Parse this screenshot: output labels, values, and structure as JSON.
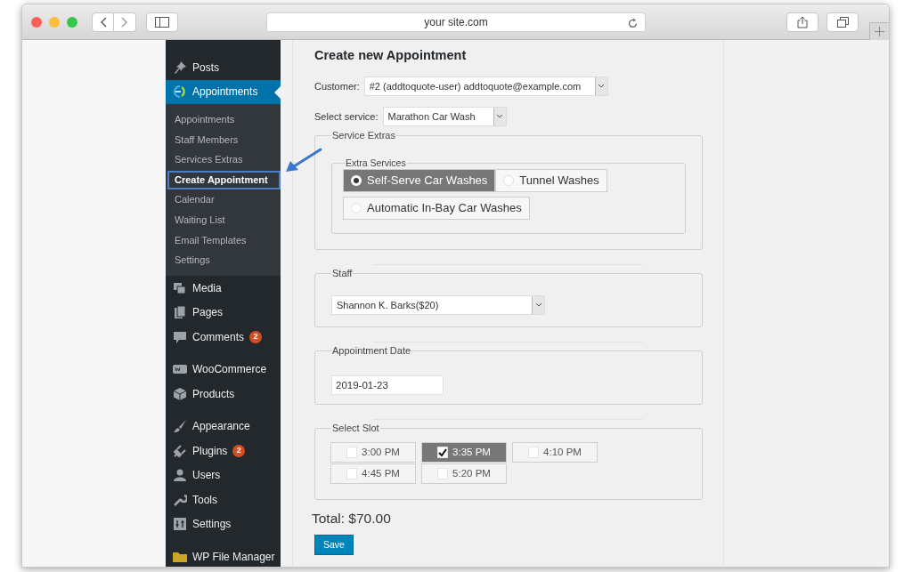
{
  "browser": {
    "url": "your site.com"
  },
  "sidebar": {
    "items": [
      {
        "label": "Posts",
        "selected": false
      },
      {
        "label": "Appointments",
        "selected": true,
        "children": [
          {
            "label": "Appointments",
            "selected": false
          },
          {
            "label": "Staff Members",
            "selected": false
          },
          {
            "label": "Services Extras",
            "selected": false
          },
          {
            "label": "Create Appointment",
            "selected": true
          },
          {
            "label": "Calendar",
            "selected": false
          },
          {
            "label": "Waiting List",
            "selected": false
          },
          {
            "label": "Email Templates",
            "selected": false
          },
          {
            "label": "Settings",
            "selected": false
          }
        ]
      },
      {
        "label": "Media",
        "selected": false
      },
      {
        "label": "Pages",
        "selected": false
      },
      {
        "label": "Comments",
        "selected": false,
        "badge": "2"
      },
      {
        "label": "WooCommerce",
        "selected": false
      },
      {
        "label": "Products",
        "selected": false
      },
      {
        "label": "Appearance",
        "selected": false
      },
      {
        "label": "Plugins",
        "selected": false,
        "badge": "2"
      },
      {
        "label": "Users",
        "selected": false
      },
      {
        "label": "Tools",
        "selected": false
      },
      {
        "label": "Settings",
        "selected": false
      },
      {
        "label": "WP File Manager",
        "selected": false
      }
    ]
  },
  "form": {
    "title": "Create new Appointment",
    "customer": {
      "label": "Customer:",
      "value": "#2 (addtoquote-user) addtoquote@example.com"
    },
    "service": {
      "label": "Select service:",
      "value": "Marathon Car Wash"
    },
    "service_extras": {
      "legend": "Service Extras",
      "group_legend": "Extra Services",
      "options": [
        {
          "label": "Self-Serve Car Washes",
          "selected": true
        },
        {
          "label": "Tunnel Washes",
          "selected": false
        },
        {
          "label": "Automatic In-Bay Car Washes",
          "selected": false
        }
      ]
    },
    "staff": {
      "legend": "Staff",
      "value": "Shannon K. Barks($20)"
    },
    "date": {
      "legend": "Appointment Date",
      "value": "2019-01-23"
    },
    "slots": {
      "legend": "Select Slot",
      "items": [
        {
          "label": "3:00 PM",
          "checked": false
        },
        {
          "label": "3:35 PM",
          "checked": true
        },
        {
          "label": "4:10 PM",
          "checked": false
        },
        {
          "label": "4:45 PM",
          "checked": false
        },
        {
          "label": "5:20 PM",
          "checked": false
        }
      ]
    },
    "total": "Total: $70.00",
    "save": "Save"
  }
}
